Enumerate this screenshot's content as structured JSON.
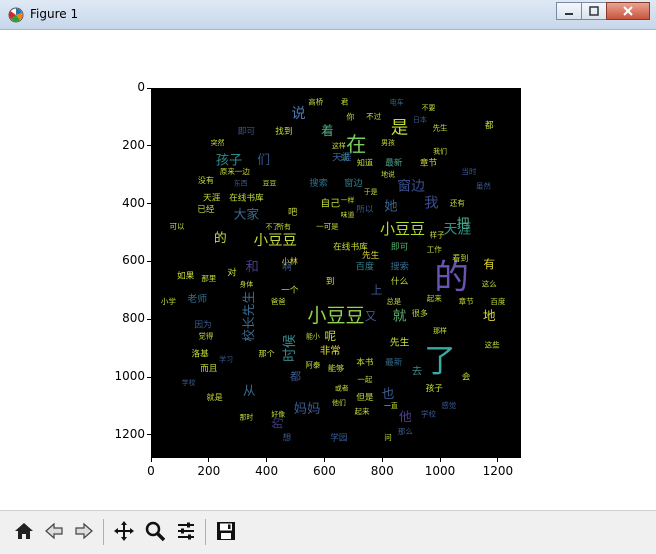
{
  "window": {
    "title": "Figure 1",
    "buttons": [
      "minimize",
      "maximize",
      "close"
    ]
  },
  "figure": {
    "x_ticks": [
      "0",
      "200",
      "400",
      "600",
      "800",
      "1000",
      "1200"
    ],
    "y_ticks": [
      "0",
      "200",
      "400",
      "600",
      "800",
      "1000",
      "1200"
    ],
    "xlim": [
      0,
      1280
    ],
    "ylim": [
      1280,
      0
    ]
  },
  "wordcloud": [
    {
      "t": "的",
      "x": 1040,
      "y": 660,
      "s": 120,
      "c": "#6a53b3"
    },
    {
      "t": "了",
      "x": 1000,
      "y": 950,
      "s": 110,
      "c": "#3aa9a0"
    },
    {
      "t": "小豆豆",
      "x": 640,
      "y": 790,
      "s": 66,
      "c": "#92d250"
    },
    {
      "t": "在",
      "x": 710,
      "y": 200,
      "s": 70,
      "c": "#76cf60"
    },
    {
      "t": "是",
      "x": 860,
      "y": 140,
      "s": 60,
      "c": "#c9dd3a"
    },
    {
      "t": "小豆豆",
      "x": 870,
      "y": 490,
      "s": 52,
      "c": "#b4de2c"
    },
    {
      "t": "天涯",
      "x": 1060,
      "y": 490,
      "s": 48,
      "c": "#2a9488"
    },
    {
      "t": "小豆豆",
      "x": 430,
      "y": 530,
      "s": 50,
      "c": "#c8dc3a"
    },
    {
      "t": "说",
      "x": 510,
      "y": 90,
      "s": 50,
      "c": "#4a78b0"
    },
    {
      "t": "窗边",
      "x": 900,
      "y": 340,
      "s": 48,
      "c": "#3c4f8e"
    },
    {
      "t": "我",
      "x": 970,
      "y": 400,
      "s": 50,
      "c": "#3b4f8c"
    },
    {
      "t": "她",
      "x": 830,
      "y": 410,
      "s": 46,
      "c": "#35628f"
    },
    {
      "t": "就",
      "x": 860,
      "y": 790,
      "s": 48,
      "c": "#5ab06d"
    },
    {
      "t": "把",
      "x": 1080,
      "y": 470,
      "s": 46,
      "c": "#4fa58a"
    },
    {
      "t": "着",
      "x": 610,
      "y": 150,
      "s": 44,
      "c": "#4cb07f"
    },
    {
      "t": "孩子",
      "x": 270,
      "y": 250,
      "s": 46,
      "c": "#2d8a8d"
    },
    {
      "t": "们",
      "x": 390,
      "y": 250,
      "s": 44,
      "c": "#375d93"
    },
    {
      "t": "大家",
      "x": 330,
      "y": 440,
      "s": 44,
      "c": "#3a6a8f"
    },
    {
      "t": "和",
      "x": 350,
      "y": 620,
      "s": 46,
      "c": "#4a3a88"
    },
    {
      "t": "的",
      "x": 240,
      "y": 520,
      "s": 44,
      "c": "#cadd3c"
    },
    {
      "t": "有",
      "x": 1170,
      "y": 610,
      "s": 40,
      "c": "#ddd531"
    },
    {
      "t": "地",
      "x": 1170,
      "y": 790,
      "s": 44,
      "c": "#d8d634"
    },
    {
      "t": "校长先生",
      "x": 340,
      "y": 790,
      "s": 44,
      "c": "#3c6a8d",
      "r": -90
    },
    {
      "t": "时候",
      "x": 480,
      "y": 900,
      "s": 48,
      "c": "#368a8b",
      "r": -90
    },
    {
      "t": "妈妈",
      "x": 540,
      "y": 1110,
      "s": 46,
      "c": "#3b5d90"
    },
    {
      "t": "也",
      "x": 820,
      "y": 1060,
      "s": 44,
      "c": "#3b5e8f"
    },
    {
      "t": "他",
      "x": 880,
      "y": 1140,
      "s": 44,
      "c": "#4c3d89"
    },
    {
      "t": "从",
      "x": 340,
      "y": 1050,
      "s": 44,
      "c": "#3a6c8e"
    },
    {
      "t": "的",
      "x": 440,
      "y": 1160,
      "s": 40,
      "c": "#433f85",
      "r": -90
    },
    {
      "t": "都",
      "x": 500,
      "y": 1000,
      "s": 38,
      "c": "#3b5a90"
    },
    {
      "t": "天涯",
      "x": 660,
      "y": 240,
      "s": 34,
      "c": "#3a5d90"
    },
    {
      "t": "窗边",
      "x": 700,
      "y": 330,
      "s": 32,
      "c": "#2e7e8d"
    },
    {
      "t": "搜索",
      "x": 580,
      "y": 330,
      "s": 32,
      "c": "#2f708e"
    },
    {
      "t": "自己",
      "x": 620,
      "y": 400,
      "s": 34,
      "c": "#c4dc3a"
    },
    {
      "t": "所以",
      "x": 740,
      "y": 420,
      "s": 30,
      "c": "#3b5a90"
    },
    {
      "t": "在线书库",
      "x": 330,
      "y": 380,
      "s": 30,
      "c": "#c6dc3a"
    },
    {
      "t": "天涯",
      "x": 210,
      "y": 380,
      "s": 30,
      "c": "#c8dc38"
    },
    {
      "t": "在线书库",
      "x": 690,
      "y": 550,
      "s": 30,
      "c": "#c8dc3a"
    },
    {
      "t": "即可",
      "x": 860,
      "y": 550,
      "s": 30,
      "c": "#4fb56e"
    },
    {
      "t": "章节",
      "x": 960,
      "y": 260,
      "s": 30,
      "c": "#d0da38"
    },
    {
      "t": "最新",
      "x": 840,
      "y": 260,
      "s": 30,
      "c": "#4fa38b"
    },
    {
      "t": "知道",
      "x": 740,
      "y": 260,
      "s": 28,
      "c": "#c0db3c"
    },
    {
      "t": "或",
      "x": 670,
      "y": 240,
      "s": 30,
      "c": "#2f808c"
    },
    {
      "t": "先生",
      "x": 760,
      "y": 580,
      "s": 30,
      "c": "#d8d836"
    },
    {
      "t": "百度",
      "x": 740,
      "y": 620,
      "s": 32,
      "c": "#2d7f8c"
    },
    {
      "t": "搜索",
      "x": 860,
      "y": 620,
      "s": 32,
      "c": "#346a8f"
    },
    {
      "t": "什么",
      "x": 860,
      "y": 670,
      "s": 30,
      "c": "#c5dc3a"
    },
    {
      "t": "到",
      "x": 620,
      "y": 670,
      "s": 30,
      "c": "#d9d735"
    },
    {
      "t": "非常",
      "x": 620,
      "y": 910,
      "s": 36,
      "c": "#d8d636"
    },
    {
      "t": "本书",
      "x": 740,
      "y": 950,
      "s": 30,
      "c": "#c0db3c"
    },
    {
      "t": "最新",
      "x": 840,
      "y": 950,
      "s": 30,
      "c": "#2f6a8f"
    },
    {
      "t": "先生",
      "x": 860,
      "y": 880,
      "s": 34,
      "c": "#c8dc3a"
    },
    {
      "t": "呢",
      "x": 620,
      "y": 860,
      "s": 40,
      "c": "#cadd3a"
    },
    {
      "t": "但是",
      "x": 740,
      "y": 1070,
      "s": 30,
      "c": "#c8dc3a"
    },
    {
      "t": "孩子",
      "x": 980,
      "y": 1040,
      "s": 30,
      "c": "#c8dc3a"
    },
    {
      "t": "去",
      "x": 920,
      "y": 980,
      "s": 36,
      "c": "#3a8b8a"
    },
    {
      "t": "洛基",
      "x": 170,
      "y": 920,
      "s": 30,
      "c": "#c8dc3a"
    },
    {
      "t": "而且",
      "x": 200,
      "y": 970,
      "s": 30,
      "c": "#c8dc3a"
    },
    {
      "t": "老师",
      "x": 160,
      "y": 730,
      "s": 34,
      "c": "#2f6f8f"
    },
    {
      "t": "因为",
      "x": 180,
      "y": 820,
      "s": 30,
      "c": "#3b5a90"
    },
    {
      "t": "如果",
      "x": 120,
      "y": 650,
      "s": 30,
      "c": "#c8dc3a"
    },
    {
      "t": "对",
      "x": 280,
      "y": 640,
      "s": 32,
      "c": "#c8dc3a"
    },
    {
      "t": "吧",
      "x": 490,
      "y": 430,
      "s": 32,
      "c": "#c8dc3a"
    },
    {
      "t": "一个",
      "x": 480,
      "y": 700,
      "s": 30,
      "c": "#c8dc3a"
    },
    {
      "t": "上",
      "x": 780,
      "y": 700,
      "s": 40,
      "c": "#3b5a90"
    },
    {
      "t": "又",
      "x": 760,
      "y": 790,
      "s": 40,
      "c": "#3b5a90"
    },
    {
      "t": "即可",
      "x": 330,
      "y": 150,
      "s": 30,
      "c": "#3b5a90"
    },
    {
      "t": "找到",
      "x": 460,
      "y": 150,
      "s": 30,
      "c": "#c8dc3a"
    },
    {
      "t": "高桥",
      "x": 570,
      "y": 50,
      "s": 26,
      "c": "#c8dc3a"
    },
    {
      "t": "你",
      "x": 690,
      "y": 100,
      "s": 28,
      "c": "#c8dc3a"
    },
    {
      "t": "不过",
      "x": 770,
      "y": 100,
      "s": 26,
      "c": "#c8dc3a"
    },
    {
      "t": "电车",
      "x": 850,
      "y": 50,
      "s": 24,
      "c": "#2f6f8f"
    },
    {
      "t": "不要",
      "x": 960,
      "y": 70,
      "s": 24,
      "c": "#c8dc3a"
    },
    {
      "t": "没有",
      "x": 190,
      "y": 320,
      "s": 28,
      "c": "#c8dc3a"
    },
    {
      "t": "已经",
      "x": 190,
      "y": 420,
      "s": 30,
      "c": "#c8dc3a"
    },
    {
      "t": "看到",
      "x": 1070,
      "y": 590,
      "s": 28,
      "c": "#c8dc3a"
    },
    {
      "t": "这些",
      "x": 1180,
      "y": 890,
      "s": 26,
      "c": "#c8dc3a"
    },
    {
      "t": "会",
      "x": 1090,
      "y": 1000,
      "s": 30,
      "c": "#c8dc3a"
    },
    {
      "t": "起来",
      "x": 980,
      "y": 730,
      "s": 26,
      "c": "#c8dc3a"
    },
    {
      "t": "章节",
      "x": 1090,
      "y": 740,
      "s": 26,
      "c": "#c8dc3a"
    },
    {
      "t": "百度",
      "x": 1200,
      "y": 740,
      "s": 26,
      "c": "#c8dc3a"
    },
    {
      "t": "学园",
      "x": 650,
      "y": 1210,
      "s": 30,
      "c": "#3b5a90"
    },
    {
      "t": "想",
      "x": 470,
      "y": 1210,
      "s": 30,
      "c": "#3b5a90"
    },
    {
      "t": "就是",
      "x": 220,
      "y": 1070,
      "s": 28,
      "c": "#c8dc3a"
    },
    {
      "t": "一起",
      "x": 740,
      "y": 1010,
      "s": 26,
      "c": "#c8dc3a"
    },
    {
      "t": "能够",
      "x": 640,
      "y": 970,
      "s": 28,
      "c": "#c8dc3a"
    },
    {
      "t": "啊",
      "x": 470,
      "y": 620,
      "s": 34,
      "c": "#3b5a90"
    },
    {
      "t": "小林",
      "x": 480,
      "y": 600,
      "s": 28,
      "c": "#d9d735"
    },
    {
      "t": "都",
      "x": 1170,
      "y": 130,
      "s": 30,
      "c": "#c8dc3a"
    },
    {
      "t": "虽然",
      "x": 1150,
      "y": 340,
      "s": 26,
      "c": "#3b5a90"
    },
    {
      "t": "当时",
      "x": 1100,
      "y": 290,
      "s": 26,
      "c": "#3b5a90"
    },
    {
      "t": "原来一边",
      "x": 290,
      "y": 290,
      "s": 26,
      "c": "#c8dc3a"
    },
    {
      "t": "很多",
      "x": 930,
      "y": 780,
      "s": 28,
      "c": "#c8dc3a"
    },
    {
      "t": "那个",
      "x": 400,
      "y": 920,
      "s": 28,
      "c": "#c8dc3a"
    },
    {
      "t": "先生",
      "x": 1000,
      "y": 140,
      "s": 26,
      "c": "#c8dc3a"
    },
    {
      "t": "日本",
      "x": 930,
      "y": 110,
      "s": 24,
      "c": "#3b5a90"
    },
    {
      "t": "男孩",
      "x": 820,
      "y": 190,
      "s": 24,
      "c": "#c8dc3a"
    },
    {
      "t": "这样",
      "x": 650,
      "y": 200,
      "s": 24,
      "c": "#c8dc3a"
    },
    {
      "t": "一样",
      "x": 680,
      "y": 390,
      "s": 24,
      "c": "#c8dc3a"
    },
    {
      "t": "可以",
      "x": 90,
      "y": 480,
      "s": 26,
      "c": "#c8dc3a"
    },
    {
      "t": "小学",
      "x": 60,
      "y": 740,
      "s": 26,
      "c": "#c8dc3a"
    },
    {
      "t": "觉得",
      "x": 190,
      "y": 860,
      "s": 26,
      "c": "#c8dc3a"
    },
    {
      "t": "工作",
      "x": 980,
      "y": 560,
      "s": 26,
      "c": "#c8dc3a"
    },
    {
      "t": "样子",
      "x": 990,
      "y": 510,
      "s": 26,
      "c": "#c8dc3a"
    },
    {
      "t": "还有",
      "x": 1060,
      "y": 400,
      "s": 26,
      "c": "#c8dc3a"
    },
    {
      "t": "那里",
      "x": 200,
      "y": 660,
      "s": 26,
      "c": "#c8dc3a"
    },
    {
      "t": "这么",
      "x": 1170,
      "y": 680,
      "s": 26,
      "c": "#c8dc3a"
    },
    {
      "t": "那么",
      "x": 880,
      "y": 1190,
      "s": 26,
      "c": "#3b5a90"
    },
    {
      "t": "起来",
      "x": 730,
      "y": 1120,
      "s": 26,
      "c": "#c8dc3a"
    },
    {
      "t": "学校",
      "x": 960,
      "y": 1130,
      "s": 26,
      "c": "#3b5a90"
    },
    {
      "t": "感觉",
      "x": 1030,
      "y": 1100,
      "s": 26,
      "c": "#3b5a90"
    },
    {
      "t": "或者",
      "x": 660,
      "y": 1040,
      "s": 24,
      "c": "#c8dc3a"
    },
    {
      "t": "他们",
      "x": 650,
      "y": 1090,
      "s": 24,
      "c": "#c8dc3a"
    },
    {
      "t": "一可是",
      "x": 610,
      "y": 480,
      "s": 26,
      "c": "#c8dc3a"
    },
    {
      "t": "所有",
      "x": 460,
      "y": 480,
      "s": 24,
      "c": "#c8dc3a"
    },
    {
      "t": "君",
      "x": 670,
      "y": 50,
      "s": 26,
      "c": "#c8dc3a"
    },
    {
      "t": "总是",
      "x": 840,
      "y": 740,
      "s": 26,
      "c": "#c8dc3a"
    },
    {
      "t": "身体",
      "x": 330,
      "y": 680,
      "s": 24,
      "c": "#c8dc3a"
    },
    {
      "t": "爸爸",
      "x": 440,
      "y": 740,
      "s": 26,
      "c": "#c8dc3a"
    },
    {
      "t": "问",
      "x": 820,
      "y": 1210,
      "s": 26,
      "c": "#c8dc3a"
    },
    {
      "t": "好像",
      "x": 440,
      "y": 1130,
      "s": 24,
      "c": "#c8dc3a"
    },
    {
      "t": "那样",
      "x": 1000,
      "y": 840,
      "s": 24,
      "c": "#c8dc3a"
    },
    {
      "t": "一直",
      "x": 830,
      "y": 1100,
      "s": 24,
      "c": "#c8dc3a"
    },
    {
      "t": "学习",
      "x": 260,
      "y": 940,
      "s": 24,
      "c": "#3b5a90"
    },
    {
      "t": "学校",
      "x": 130,
      "y": 1020,
      "s": 24,
      "c": "#3b5a90"
    },
    {
      "t": "那时",
      "x": 330,
      "y": 1140,
      "s": 24,
      "c": "#c8dc3a"
    },
    {
      "t": "不了",
      "x": 420,
      "y": 480,
      "s": 24,
      "c": "#c8dc3a"
    },
    {
      "t": "我们",
      "x": 1000,
      "y": 220,
      "s": 24,
      "c": "#c8dc3a"
    },
    {
      "t": "地说",
      "x": 820,
      "y": 300,
      "s": 24,
      "c": "#c8dc3a"
    },
    {
      "t": "于是",
      "x": 760,
      "y": 360,
      "s": 24,
      "c": "#c8dc3a"
    },
    {
      "t": "味道",
      "x": 680,
      "y": 440,
      "s": 24,
      "c": "#c8dc3a"
    },
    {
      "t": "东西",
      "x": 310,
      "y": 330,
      "s": 24,
      "c": "#3b5a90"
    },
    {
      "t": "豆豆",
      "x": 410,
      "y": 330,
      "s": 24,
      "c": "#c8dc3a"
    },
    {
      "t": "突然",
      "x": 230,
      "y": 190,
      "s": 24,
      "c": "#c8dc3a"
    },
    {
      "t": "阿泰",
      "x": 560,
      "y": 960,
      "s": 26,
      "c": "#c8dc3a"
    },
    {
      "t": "能小",
      "x": 560,
      "y": 860,
      "s": 24,
      "c": "#c8dc3a"
    }
  ]
}
